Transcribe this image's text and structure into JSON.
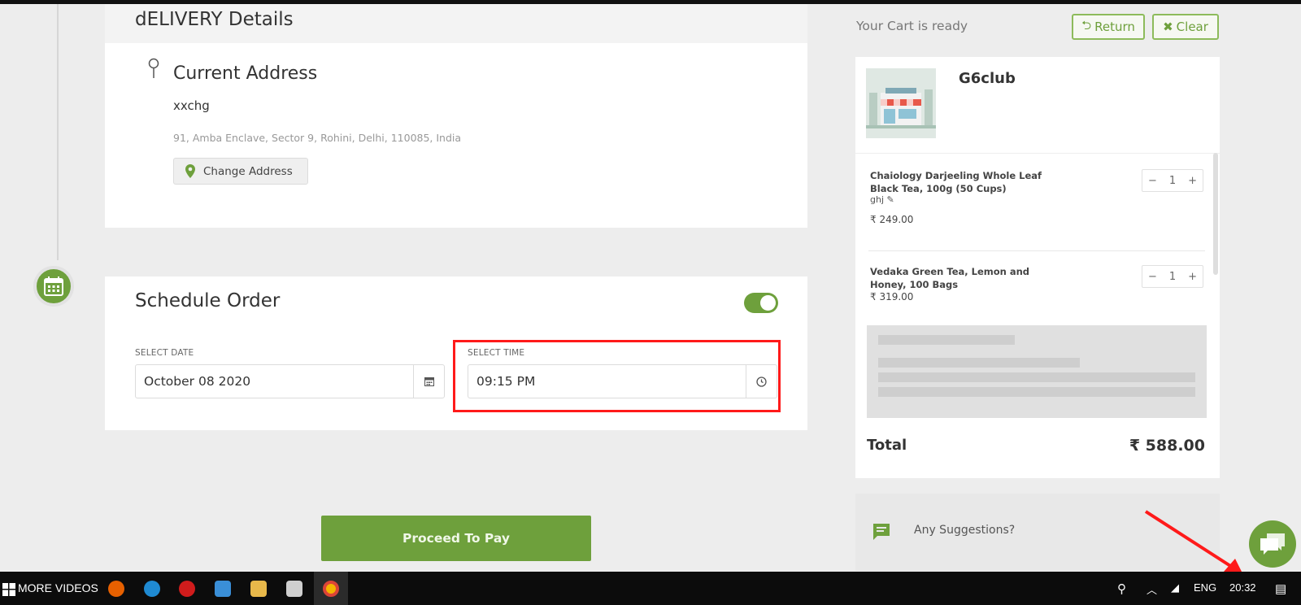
{
  "delivery": {
    "title": "dELIVERY Details",
    "address_title": "Current Address",
    "address_name": "xxchg",
    "address_line": "91, Amba Enclave, Sector 9, Rohini, Delhi, 110085, India",
    "change_address_label": "Change Address"
  },
  "schedule": {
    "title": "Schedule Order",
    "toggle_on": true,
    "date_label": "SELECT DATE",
    "date_value": "October 08 2020",
    "time_label": "SELECT TIME",
    "time_value": "09:15 PM"
  },
  "proceed_label": "Proceed To Pay",
  "cart": {
    "ready_text": "Your Cart is ready",
    "return_label": "Return",
    "clear_label": "Clear",
    "store_name": "G6club",
    "items": [
      {
        "name": "Chaiology Darjeeling Whole Leaf Black Tea, 100g (50 Cups)",
        "note": "ghj",
        "qty": "1",
        "price": "₹ 249.00"
      },
      {
        "name": "Vedaka Green Tea, Lemon and Honey, 100 Bags",
        "qty": "1",
        "price": "₹ 319.00"
      }
    ],
    "total_label": "Total",
    "total_value": "₹ 588.00"
  },
  "suggestions_label": "Any Suggestions?",
  "taskbar": {
    "start_label": "MORE VIDEOS",
    "language": "ENG",
    "clock": "20:32"
  },
  "colors": {
    "accent": "#6ea03c",
    "highlight": "#ff1a1a"
  }
}
